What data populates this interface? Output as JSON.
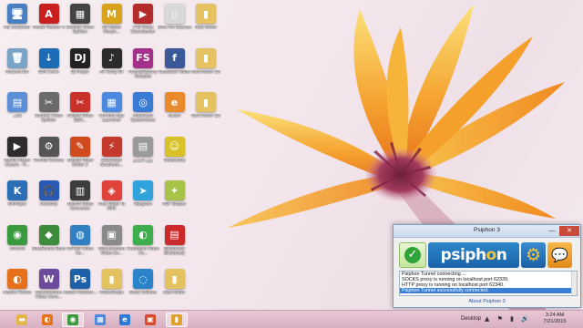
{
  "desktop": {
    "icons": [
      {
        "label": "My computer",
        "icon": "computer-icon",
        "color": "#4a7fc1",
        "glyph": "🖥"
      },
      {
        "label": "Recycle Bin",
        "icon": "recycle-bin-icon",
        "color": "#7aa3c8",
        "glyph": "🗑"
      },
      {
        "label": "قالب",
        "icon": "document-icon",
        "color": "#5d8fd6",
        "glyph": "▤"
      },
      {
        "label": "Media Player Classic - H...",
        "icon": "media-player-icon",
        "color": "#2d2d2d",
        "glyph": "▶"
      },
      {
        "label": "KMPlayer",
        "icon": "kmplayer-icon",
        "color": "#2c6fb6",
        "glyph": "K"
      },
      {
        "label": "chrome",
        "icon": "chrome-icon",
        "color": "#3a9a3e",
        "glyph": "◉"
      },
      {
        "label": "Mozilla Firefox",
        "icon": "firefox-icon",
        "color": "#e7711b",
        "glyph": "◐"
      },
      {
        "label": "Adobe Reader X",
        "icon": "adobe-reader-icon",
        "color": "#c9201f",
        "glyph": "A"
      },
      {
        "label": "IDM Crack",
        "icon": "idm-icon",
        "color": "#1d6ab5",
        "glyph": "↓"
      },
      {
        "label": "Sothink Video Splitter",
        "icon": "video-splitter-icon",
        "color": "#6a6a6a",
        "glyph": "✂"
      },
      {
        "label": "Format Factory",
        "icon": "format-factory-icon",
        "color": "#555",
        "glyph": "⚙"
      },
      {
        "label": "Audacity",
        "icon": "audacity-icon",
        "color": "#2a59b5",
        "glyph": "🎧"
      },
      {
        "label": "BlueStacks Start",
        "icon": "bluestacks-icon",
        "color": "#3c8c3c",
        "glyph": "◆"
      },
      {
        "label": "Wondershare Video Conv...",
        "icon": "wondershare-icon",
        "color": "#6b4a9c",
        "glyph": "W"
      },
      {
        "label": "Sothink Video Splitter",
        "icon": "video-splitter-icon",
        "color": "#444",
        "glyph": "▦"
      },
      {
        "label": "DJ Player",
        "icon": "dj-player-icon",
        "color": "#222",
        "glyph": "DJ"
      },
      {
        "label": "Xilisoft Video Split...",
        "icon": "xilisoft-icon",
        "color": "#c8322a",
        "glyph": "✂"
      },
      {
        "label": "Xilisoft Video Editor 2",
        "icon": "xilisoft-editor-icon",
        "color": "#d04a1e",
        "glyph": "✎"
      },
      {
        "label": "Xilisoft Video Converter",
        "icon": "film-icon",
        "color": "#3d3d3d",
        "glyph": "▥"
      },
      {
        "label": "ImTOO Video Co...",
        "icon": "imtoo-icon",
        "color": "#2f7fc2",
        "glyph": "◍"
      },
      {
        "label": "Adobe Photosh...",
        "icon": "photoshop-icon",
        "color": "#1d5fa8",
        "glyph": "Ps"
      },
      {
        "label": "AV Media Morph...",
        "icon": "av-media-icon",
        "color": "#d8a21b",
        "glyph": "M"
      },
      {
        "label": "AV Song Gif",
        "icon": "av-song-icon",
        "color": "#2b2b2b",
        "glyph": "♪"
      },
      {
        "label": "Chrome App Launcher",
        "icon": "app-launcher-icon",
        "color": "#4b8ae0",
        "glyph": "▦"
      },
      {
        "label": "Download Accelerat...",
        "icon": "download-accelerator-icon",
        "color": "#c43a2c",
        "glyph": "⚡"
      },
      {
        "label": "Free Video To MP3",
        "icon": "video-mp3-icon",
        "color": "#e0433a",
        "glyph": "◈"
      },
      {
        "label": "Wondershare Video Co...",
        "icon": "wondershare-video-icon",
        "color": "#8a8a8a",
        "glyph": "▣"
      },
      {
        "label": "PhotoScape",
        "icon": "folder-icon",
        "color": "#e4c25f",
        "glyph": "▮"
      },
      {
        "label": "YTD Video Downloader",
        "icon": "ytd-icon",
        "color": "#b52b2b",
        "glyph": "▶"
      },
      {
        "label": "FormatFactory Portable",
        "icon": "formatfactory-portable-icon",
        "color": "#a3308a",
        "glyph": "FS"
      },
      {
        "label": "Advanced SystemCare",
        "icon": "systemcare-icon",
        "color": "#3a7bd5",
        "glyph": "◎"
      },
      {
        "label": "وزن الفيديو",
        "icon": "weight-icon",
        "color": "#9a9a9a",
        "glyph": "▤"
      },
      {
        "label": "Telegram",
        "icon": "telegram-icon",
        "color": "#2ea3dc",
        "glyph": "➤"
      },
      {
        "label": "Freemake Video Co...",
        "icon": "freemake-icon",
        "color": "#3cae4b",
        "glyph": "◐"
      },
      {
        "label": "Glary Utilities",
        "icon": "glary-icon",
        "color": "#2b83c9",
        "glyph": "◌"
      },
      {
        "label": "Nitro Pro Express",
        "icon": "nitro-icon",
        "color": "#d9d9d9",
        "glyph": "▯"
      },
      {
        "label": "Facebook Video",
        "icon": "facebook-video-icon",
        "color": "#3b5998",
        "glyph": "f"
      },
      {
        "label": "eLean",
        "icon": "elean-icon",
        "color": "#e98a2c",
        "glyph": "e"
      },
      {
        "label": "Tubebuddy",
        "icon": "tubebuddy-icon",
        "color": "#d9c12a",
        "glyph": "☺"
      },
      {
        "label": "PDF Shaper",
        "icon": "pdf-shaper-icon",
        "color": "#a8c24a",
        "glyph": "✦"
      },
      {
        "label": "Dictionary Dictionary",
        "icon": "dictionary-icon",
        "color": "#cc2a2a",
        "glyph": "▤"
      },
      {
        "label": "New folder",
        "icon": "folder-icon",
        "color": "#e4c25f",
        "glyph": "▮"
      },
      {
        "label": "New folder",
        "icon": "folder-icon",
        "color": "#e4c25f",
        "glyph": "▮"
      },
      {
        "label": "New folder (3)",
        "icon": "folder-icon",
        "color": "#e4c25f",
        "glyph": "▮"
      },
      {
        "label": "New folder (2)",
        "icon": "folder-icon",
        "color": "#e4c25f",
        "glyph": "▮"
      }
    ]
  },
  "psiphon": {
    "title": "Psiphon 3",
    "minimize_glyph": "—",
    "close_glyph": "✕",
    "check_glyph": "✓",
    "logo_pre": "psiph",
    "logo_o": "o",
    "logo_post": "n",
    "settings_glyph": "⚙",
    "feedback_glyph": "💬",
    "log": [
      "Psiphon Tunnel connecting ...",
      "SOCKS proxy is running on localhost port 62339.",
      "HTTP proxy is running on localhost port 62340.",
      "Psiphon Tunnel successfully connected."
    ],
    "about_link": "About Psiphon 3",
    "accent_color": "#2c86c9"
  },
  "taskbar": {
    "buttons": [
      {
        "icon": "file-explorer-icon",
        "color": "#e1b74a",
        "glyph": "▬",
        "active": false
      },
      {
        "icon": "firefox-icon",
        "color": "#e7711b",
        "glyph": "◐",
        "active": false
      },
      {
        "icon": "chrome-icon",
        "color": "#3a9a3e",
        "glyph": "◉",
        "active": true
      },
      {
        "icon": "app-launcher-icon",
        "color": "#4b8ae0",
        "glyph": "▦",
        "active": false
      },
      {
        "icon": "internet-explorer-icon",
        "color": "#2b7bd8",
        "glyph": "e",
        "active": false
      },
      {
        "icon": "photo-app-icon",
        "color": "#d94a2b",
        "glyph": "▣",
        "active": false
      },
      {
        "icon": "psiphon-icon",
        "color": "#e0a12b",
        "glyph": "▮",
        "active": true
      }
    ],
    "desktop_label": "Desktop",
    "tray_glyphs": "▲ ⚑ ▮ 🔊",
    "clock_time": "3:24 AM",
    "clock_date": "7/21/2015"
  }
}
